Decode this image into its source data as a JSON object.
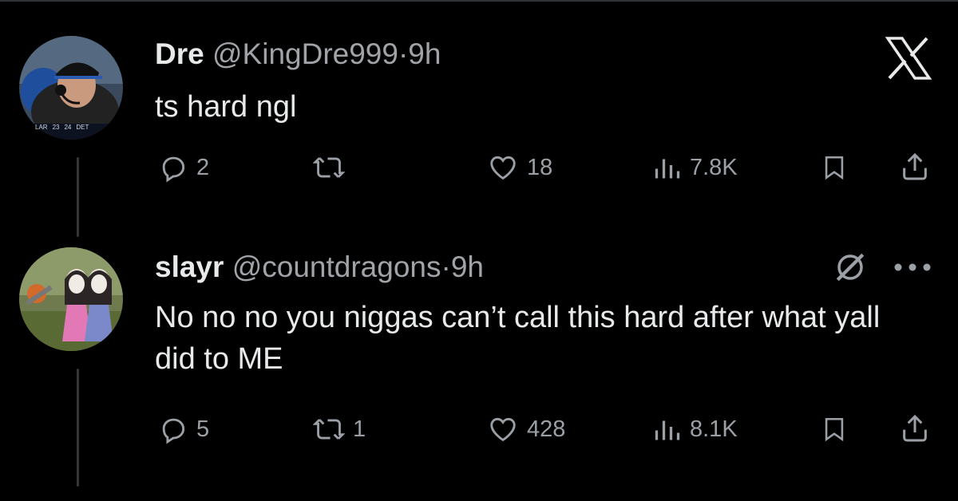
{
  "tweets": [
    {
      "name": "Dre",
      "handle": "@KingDre999",
      "separator": "·",
      "time": "9h",
      "text": "ts hard ngl",
      "avatar_scoreboard": [
        "LAR",
        "23",
        "24",
        "DET"
      ],
      "actions": {
        "replies": "2",
        "reposts": "",
        "likes": "18",
        "views": "7.8K"
      },
      "icons": [
        "reply-icon",
        "repost-icon",
        "like-icon",
        "views-icon",
        "bookmark-icon",
        "share-icon"
      ]
    },
    {
      "name": "slayr",
      "handle": "@countdragons",
      "separator": "·",
      "time": "9h",
      "text": "No no no you niggas can’t call this hard after what yall did to ME",
      "actions": {
        "replies": "5",
        "reposts": "1",
        "likes": "428",
        "views": "8.1K"
      },
      "icons": [
        "grok-icon",
        "more-icon",
        "reply-icon",
        "repost-icon",
        "like-icon",
        "views-icon",
        "bookmark-icon",
        "share-icon"
      ]
    }
  ],
  "brand": {
    "logo": "x-logo-icon"
  },
  "colors": {
    "background": "#000000",
    "text": "#e7e9ea",
    "muted": "#a0a4a8",
    "line": "#333639"
  }
}
